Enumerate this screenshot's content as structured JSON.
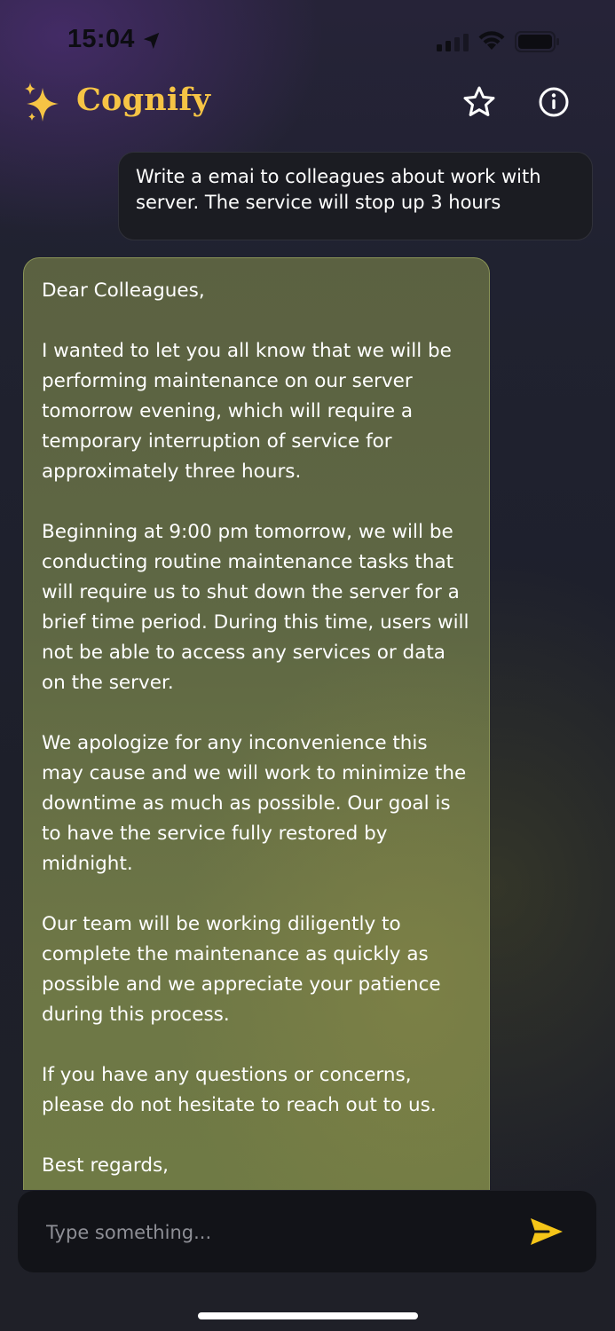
{
  "status_bar": {
    "time": "15:04",
    "icons": [
      "location-arrow-icon",
      "cellular-signal-icon",
      "wifi-icon",
      "battery-icon"
    ]
  },
  "header": {
    "title": "Cognify",
    "logo_icon": "sparkles-icon",
    "actions": [
      "star-icon",
      "info-icon"
    ]
  },
  "conversation": {
    "user_message": "Write a emai to colleagues about work with server. The service will stop up 3 hours",
    "assistant_message": {
      "paragraphs": [
        "Dear Colleagues,",
        "I wanted to let you all know that we will be performing maintenance on our server tomorrow evening, which will require a temporary interruption of service for approximately three hours.",
        "Beginning at 9:00 pm tomorrow, we will be conducting routine maintenance tasks that will require us to shut down the server for a brief time period. During this time, users will not be able to access any services or data on the server.",
        "We apologize for any inconvenience this may cause and we will work to minimize the downtime as much as possible. Our goal is to have the service fully restored by midnight.",
        "Our team will be working diligently to complete the maintenance as quickly as possible and we appreciate your patience during this process.",
        "If you have any questions or concerns, please do not hesitate to reach out to us.",
        "Best regards,"
      ]
    }
  },
  "composer": {
    "placeholder": "Type something...",
    "value": "",
    "send_icon": "send-arrow-icon"
  },
  "colors": {
    "brand": "#f6c445",
    "send": "#f5c518",
    "assistant_bubble": "#636b45",
    "user_bubble": "#1b1c22"
  }
}
